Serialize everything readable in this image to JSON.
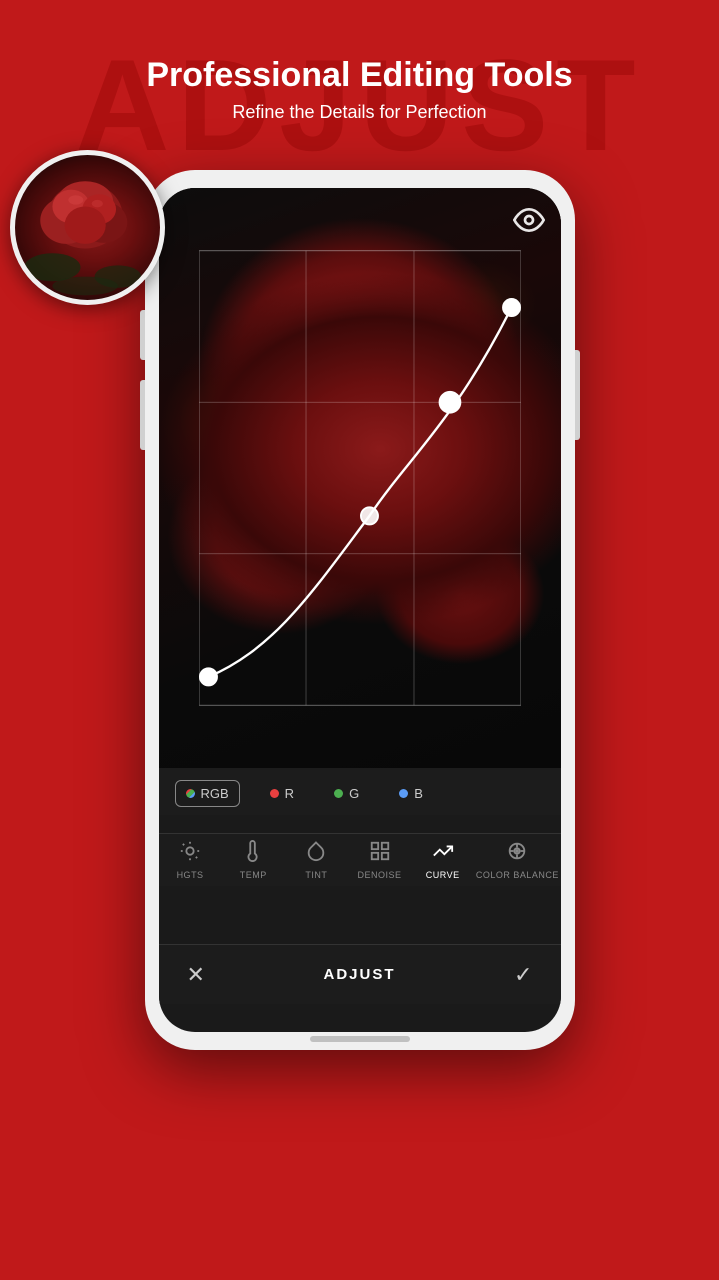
{
  "background": {
    "color": "#c0191a",
    "watermark_text": "ADJUST"
  },
  "header": {
    "title": "Professional Editing Tools",
    "subtitle": "Refine the Details for Perfection"
  },
  "circle_preview": {
    "label": "original-preview"
  },
  "image_area": {
    "label": "photo-edit-area"
  },
  "rgb_tabs": [
    {
      "id": "rgb",
      "label": "RGB",
      "color": "#e84040",
      "active": true
    },
    {
      "id": "r",
      "label": "R",
      "color": "#e84040",
      "active": false
    },
    {
      "id": "g",
      "label": "G",
      "color": "#4caf50",
      "active": false
    },
    {
      "id": "b",
      "label": "B",
      "color": "#5b9cf6",
      "active": false
    }
  ],
  "toolbar": {
    "tools": [
      {
        "id": "highlights",
        "label": "HGTS",
        "icon": "☀",
        "active": false
      },
      {
        "id": "temp",
        "label": "TEMP",
        "icon": "🌡",
        "active": false
      },
      {
        "id": "tint",
        "label": "TINT",
        "icon": "💧",
        "active": false
      },
      {
        "id": "denoise",
        "label": "DENOISE",
        "icon": "⊞",
        "active": false
      },
      {
        "id": "curve",
        "label": "CURVE",
        "icon": "↗",
        "active": true
      },
      {
        "id": "color_balance",
        "label": "COLOR BALANCE",
        "icon": "⊙",
        "active": false
      }
    ]
  },
  "action_bar": {
    "cancel_icon": "✕",
    "title": "ADJUST",
    "confirm_icon": "✓"
  }
}
